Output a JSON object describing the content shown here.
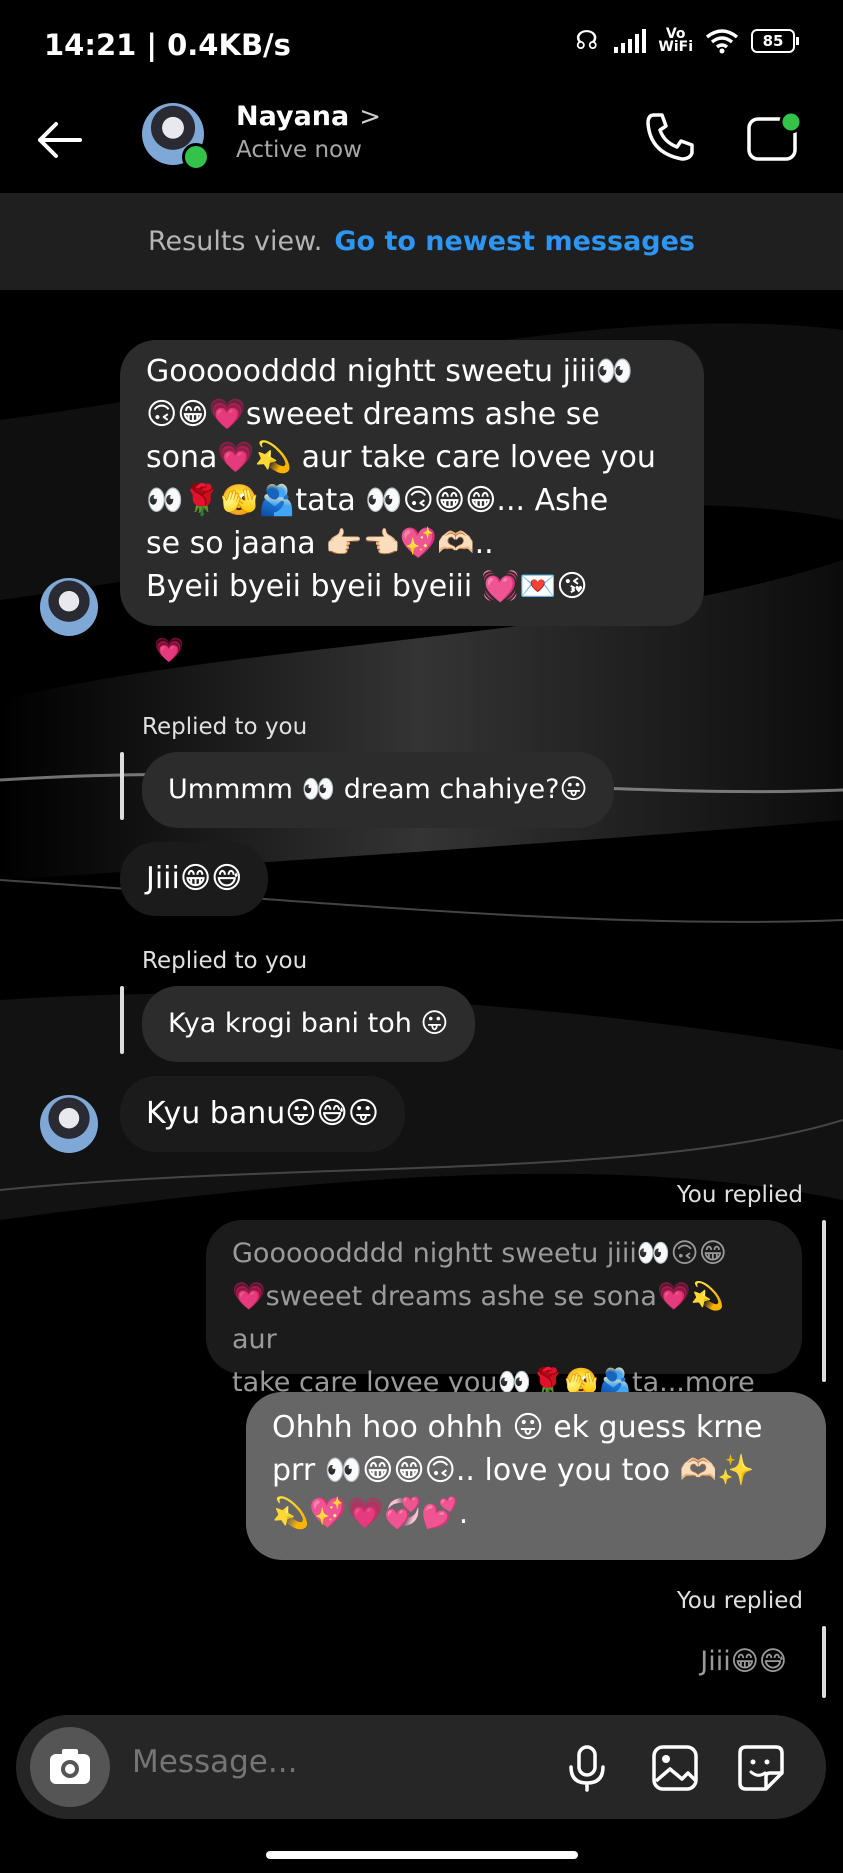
{
  "status_bar": {
    "time_speed": "14:21 | 0.4KB/s",
    "network_label_top": "Vo",
    "network_label_bottom": "WiFi",
    "battery": "85"
  },
  "header": {
    "contact_name": "Nayana",
    "chevron": ">",
    "presence": "Active now"
  },
  "banner": {
    "text": "Results view.",
    "link": "Go to newest messages",
    "link_color": "#2d95f2"
  },
  "messages": {
    "m1": {
      "line1": "Gooooodddd nightt  sweetu jiii👀",
      "line2": "🙃😁💗sweeet dreams ashe se",
      "line3": "sona💗💫 aur take care lovee you",
      "line4": "👀🌹🫣🫂tata 👀🙃😁😁... Ashe",
      "line5": "se so jaana   👉🏻👈🏻💖🫶🏻..",
      "line6": "Byeii byeii byeii byeiii 💓💌😘",
      "reaction": "💗"
    },
    "r1_label": "Replied to you",
    "r1_quote": "Ummmm 👀 dream chahiye?😛",
    "m2": "Jiii😁😅",
    "r2_label": "Replied to you",
    "r2_quote": "Kya krogi bani toh 😛",
    "m3": "Kyu banu😛😅😛",
    "you_replied_1": "You replied",
    "q1": {
      "line1": "Gooooodddd nightt  sweetu jiii👀🙃😁",
      "line2": "💗sweeet dreams ashe se sona💗💫 aur",
      "line3": "take care lovee you👀🌹🫣🫂ta...more"
    },
    "m4": {
      "line1": "Ohhh hoo ohhh 😛 ek guess krne",
      "line2": "prr 👀😁😁🙃.. love you too 🫶🏻✨",
      "line3": "💫💖💗💞💕."
    },
    "you_replied_2": "You replied",
    "q2": "Jiii😁😅"
  },
  "composer": {
    "placeholder": "Message..."
  },
  "icons": [
    "back-arrow-icon",
    "call-icon",
    "video-call-icon",
    "camera-icon",
    "microphone-icon",
    "gallery-icon",
    "sticker-icon"
  ]
}
